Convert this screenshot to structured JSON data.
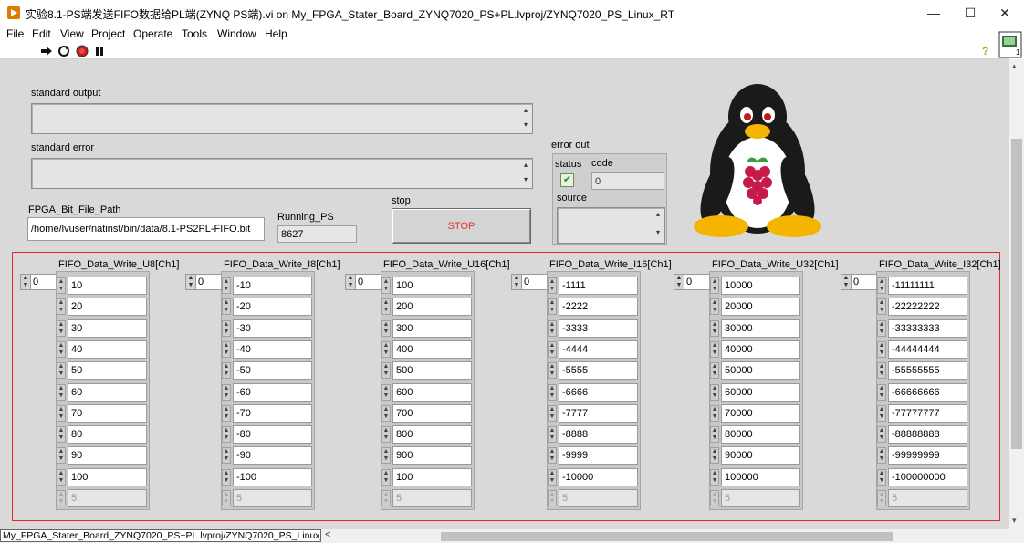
{
  "window": {
    "title": "实验8.1-PS端发送FIFO数据给PL端(ZYNQ PS端).vi on My_FPGA_Stater_Board_ZYNQ7020_PS+PL.lvproj/ZYNQ7020_PS_Linux_RT",
    "minimize": "—",
    "maximize": "☐",
    "close": "✕"
  },
  "menu": [
    "File",
    "Edit",
    "View",
    "Project",
    "Operate",
    "Tools",
    "Window",
    "Help"
  ],
  "toolbar": {
    "run_icon": "run-arrow-icon",
    "run_continuous_icon": "run-continuously-icon",
    "abort_icon": "abort-icon",
    "pause_icon": "pause-icon",
    "help_icon": "context-help-icon",
    "vi_icon": "vi-connector-icon",
    "help_glyph": "?"
  },
  "panel": {
    "standard_output_label": "standard output",
    "standard_error_label": "standard error",
    "fpga_path_label": "FPGA_Bit_File_Path",
    "fpga_path_value": "/home/lvuser/natinst/bin/data/8.1-PS2PL-FIFO.bit",
    "running_ps_label": "Running_PS",
    "running_ps_value": "8627",
    "stop_label": "stop",
    "stop_button": "STOP",
    "error_out_label": "error out",
    "status_label": "status",
    "status_check": "✔",
    "code_label": "code",
    "code_value": "0",
    "source_label": "source",
    "logo": "tux-raspberry-logo"
  },
  "arrays": [
    {
      "label": "FIFO_Data_Write_U8[Ch1]",
      "index": "0",
      "values": [
        "10",
        "20",
        "30",
        "40",
        "50",
        "60",
        "70",
        "80",
        "90",
        "100"
      ],
      "next": "5"
    },
    {
      "label": "FIFO_Data_Write_I8[Ch1]",
      "index": "0",
      "values": [
        "-10",
        "-20",
        "-30",
        "-40",
        "-50",
        "-60",
        "-70",
        "-80",
        "-90",
        "-100"
      ],
      "next": "5"
    },
    {
      "label": "FIFO_Data_Write_U16[Ch1]",
      "index": "0",
      "values": [
        "100",
        "200",
        "300",
        "400",
        "500",
        "600",
        "700",
        "800",
        "900",
        "100"
      ],
      "next": "5"
    },
    {
      "label": "FIFO_Data_Write_I16[Ch1]",
      "index": "0",
      "values": [
        "-1111",
        "-2222",
        "-3333",
        "-4444",
        "-5555",
        "-6666",
        "-7777",
        "-8888",
        "-9999",
        "-10000"
      ],
      "next": "5"
    },
    {
      "label": "FIFO_Data_Write_U32[Ch1]",
      "index": "0",
      "values": [
        "10000",
        "20000",
        "30000",
        "40000",
        "50000",
        "60000",
        "70000",
        "80000",
        "90000",
        "100000"
      ],
      "next": "5"
    },
    {
      "label": "FIFO_Data_Write_I32[Ch1]",
      "index": "0",
      "values": [
        "-11111111",
        "-22222222",
        "-33333333",
        "-44444444",
        "-55555555",
        "-66666666",
        "-77777777",
        "-88888888",
        "-99999999",
        "-100000000"
      ],
      "next": "5"
    }
  ],
  "statusbar": {
    "path": "My_FPGA_Stater_Board_ZYNQ7020_PS+PL.lvproj/ZYNQ7020_PS_Linux_RT",
    "scroll_left": "<"
  },
  "colors": {
    "panel_bg": "#d9d9d9",
    "highlight_frame": "#e0282e",
    "stop_text": "#e03030"
  }
}
